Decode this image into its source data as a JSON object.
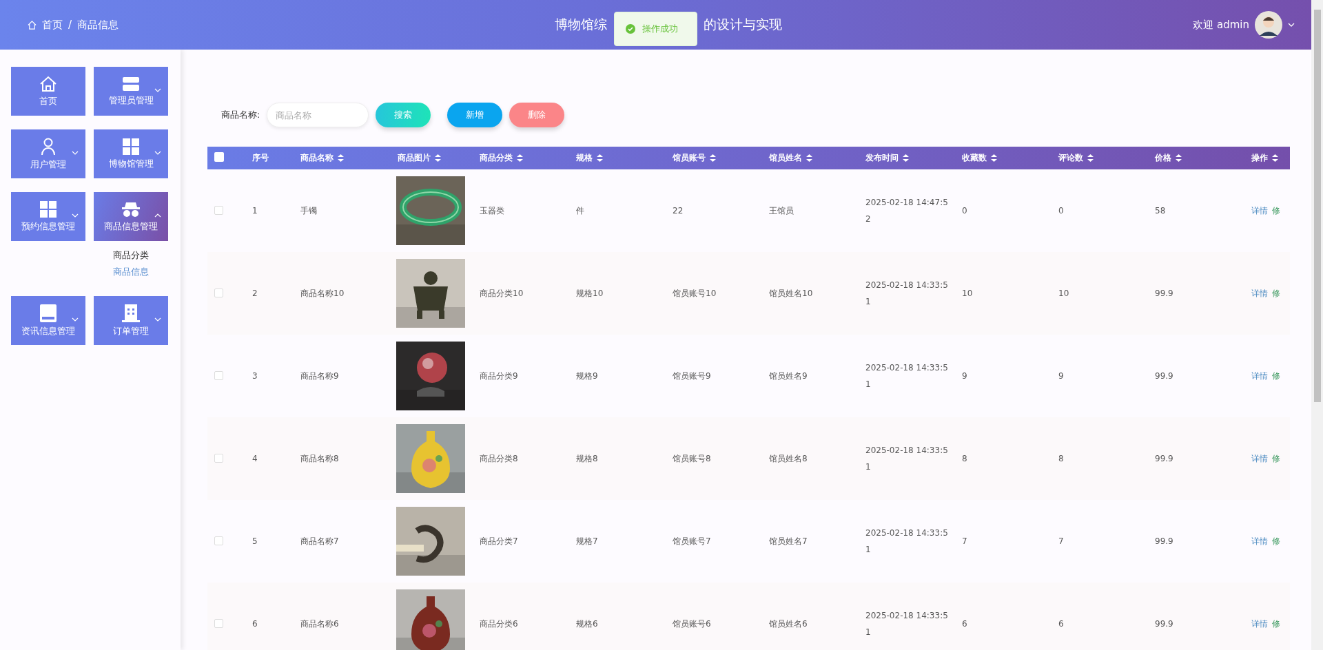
{
  "header": {
    "breadcrumb": [
      "首页",
      "商品信息"
    ],
    "separator": "/",
    "title_left": "博物馆综",
    "title_right": "的设计与实现",
    "toast": "操作成功",
    "welcome": "欢迎 admin"
  },
  "sidebar": {
    "items": [
      {
        "label": "首页",
        "expandable": false,
        "selected": false
      },
      {
        "label": "管理员管理",
        "expandable": true,
        "selected": false
      },
      {
        "label": "用户管理",
        "expandable": true,
        "selected": false
      },
      {
        "label": "博物馆管理",
        "expandable": true,
        "selected": false
      },
      {
        "label": "预约信息管理",
        "expandable": true,
        "selected": false
      },
      {
        "label": "商品信息管理",
        "expandable": true,
        "selected": true,
        "children": [
          {
            "label": "商品分类",
            "selected": false
          },
          {
            "label": "商品信息",
            "selected": true
          }
        ]
      },
      {
        "label": "资讯信息管理",
        "expandable": true,
        "selected": false
      },
      {
        "label": "订单管理",
        "expandable": true,
        "selected": false
      }
    ]
  },
  "search": {
    "label": "商品名称:",
    "placeholder": "商品名称",
    "buttons": [
      {
        "label": "搜索",
        "kind": "search"
      },
      {
        "label": "新增",
        "kind": "add"
      },
      {
        "label": "删除",
        "kind": "delete"
      }
    ]
  },
  "table": {
    "all_checked": false,
    "columns": [
      "序号",
      "商品名称",
      "商品图片",
      "商品分类",
      "规格",
      "馆员账号",
      "馆员姓名",
      "发布时间",
      "收藏数",
      "评论数",
      "价格",
      "操作"
    ],
    "rows": [
      {
        "checked": false,
        "cells": [
          "1",
          "手镯",
          {
            "kind": "picture"
          },
          "玉器类",
          "件",
          "22",
          "王馆员",
          "2025-02-18 14:47:52",
          "0",
          "0",
          "58"
        ],
        "actions": [
          "详情",
          "修"
        ]
      },
      {
        "checked": false,
        "cells": [
          "2",
          "商品名称10",
          {
            "kind": "picture"
          },
          "商品分类10",
          "规格10",
          "馆员账号10",
          "馆员姓名10",
          "2025-02-18 14:33:51",
          "10",
          "10",
          "99.9"
        ],
        "actions": [
          "详情",
          "修"
        ]
      },
      {
        "checked": false,
        "cells": [
          "3",
          "商品名称9",
          {
            "kind": "picture"
          },
          "商品分类9",
          "规格9",
          "馆员账号9",
          "馆员姓名9",
          "2025-02-18 14:33:51",
          "9",
          "9",
          "99.9"
        ],
        "actions": [
          "详情",
          "修"
        ]
      },
      {
        "checked": false,
        "cells": [
          "4",
          "商品名称8",
          {
            "kind": "picture"
          },
          "商品分类8",
          "规格8",
          "馆员账号8",
          "馆员姓名8",
          "2025-02-18 14:33:51",
          "8",
          "8",
          "99.9"
        ],
        "actions": [
          "详情",
          "修"
        ]
      },
      {
        "checked": false,
        "cells": [
          "5",
          "商品名称7",
          {
            "kind": "picture"
          },
          "商品分类7",
          "规格7",
          "馆员账号7",
          "馆员姓名7",
          "2025-02-18 14:33:51",
          "7",
          "7",
          "99.9"
        ],
        "actions": [
          "详情",
          "修"
        ]
      },
      {
        "checked": false,
        "cells": [
          "6",
          "商品名称6",
          {
            "kind": "picture"
          },
          "商品分类6",
          "规格6",
          "馆员账号6",
          "馆员姓名6",
          "2025-02-18 14:33:51",
          "6",
          "6",
          "99.9"
        ],
        "actions": [
          "详情",
          "修"
        ]
      }
    ]
  }
}
